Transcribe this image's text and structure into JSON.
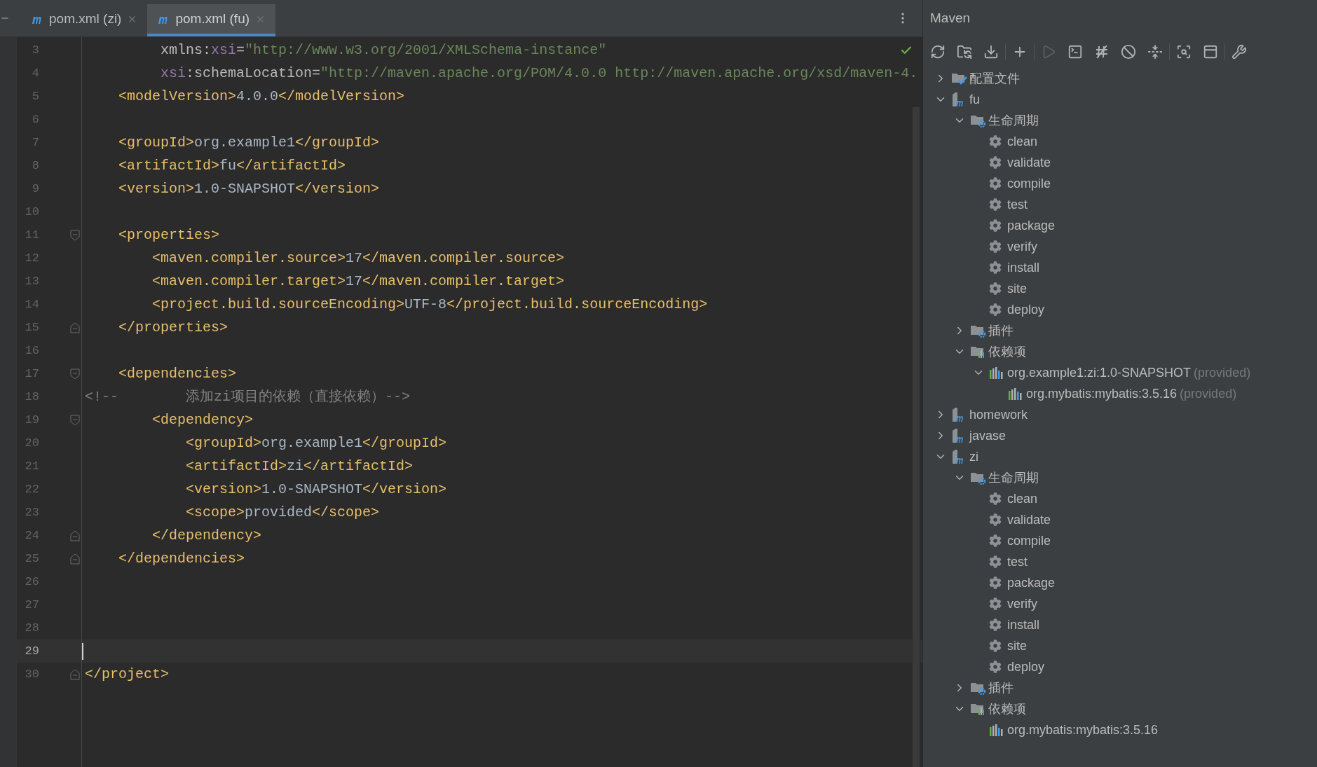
{
  "editor": {
    "tabs": [
      {
        "label": "pom.xml (zi)",
        "selected": false
      },
      {
        "label": "pom.xml (fu)",
        "selected": true
      }
    ],
    "lines": [
      {
        "number": "3",
        "current": false,
        "kind": "plain",
        "segments": [
          {
            "kind": "attr",
            "text": "         xmlns:"
          },
          {
            "kind": "ns",
            "text": "xsi"
          },
          {
            "kind": "attr",
            "text": "="
          },
          {
            "kind": "string",
            "text": "\"http://www.w3.org/2001/XMLSchema-instance\""
          }
        ]
      },
      {
        "number": "4",
        "current": false,
        "kind": "plain",
        "segments": [
          {
            "kind": "ns",
            "text": "         xsi"
          },
          {
            "kind": "attr",
            "text": ":schemaLocation="
          },
          {
            "kind": "string",
            "text": "\"http://maven.apache.org/POM/4.0.0 http://maven.apache.org/xsd/maven-4."
          }
        ]
      },
      {
        "number": "5",
        "current": false,
        "kind": "plain",
        "segments": [
          {
            "kind": "tag",
            "text": "    <modelVersion>"
          },
          {
            "kind": "text",
            "text": "4.0.0"
          },
          {
            "kind": "tag",
            "text": "</modelVersion>"
          }
        ]
      },
      {
        "number": "6",
        "current": false,
        "kind": "plain"
      },
      {
        "number": "7",
        "current": false,
        "kind": "plain",
        "segments": [
          {
            "kind": "tag",
            "text": "    <groupId>"
          },
          {
            "kind": "text",
            "text": "org.example1"
          },
          {
            "kind": "tag",
            "text": "</groupId>"
          }
        ]
      },
      {
        "number": "8",
        "current": false,
        "kind": "plain",
        "segments": [
          {
            "kind": "tag",
            "text": "    <artifactId>"
          },
          {
            "kind": "text",
            "text": "fu"
          },
          {
            "kind": "tag",
            "text": "</artifactId>"
          }
        ]
      },
      {
        "number": "9",
        "current": false,
        "kind": "plain",
        "segments": [
          {
            "kind": "tag",
            "text": "    <version>"
          },
          {
            "kind": "text",
            "text": "1.0-SNAPSHOT"
          },
          {
            "kind": "tag",
            "text": "</version>"
          }
        ]
      },
      {
        "number": "10",
        "current": false,
        "kind": "plain"
      },
      {
        "number": "11",
        "current": false,
        "kind": "fold-open",
        "segments": [
          {
            "kind": "tag",
            "text": "    <properties>"
          }
        ]
      },
      {
        "number": "12",
        "current": false,
        "kind": "plain",
        "segments": [
          {
            "kind": "tag",
            "text": "        <maven.compiler.source>"
          },
          {
            "kind": "text",
            "text": "17"
          },
          {
            "kind": "tag",
            "text": "</maven.compiler.source>"
          }
        ]
      },
      {
        "number": "13",
        "current": false,
        "kind": "plain",
        "segments": [
          {
            "kind": "tag",
            "text": "        <maven.compiler.target>"
          },
          {
            "kind": "text",
            "text": "17"
          },
          {
            "kind": "tag",
            "text": "</maven.compiler.target>"
          }
        ]
      },
      {
        "number": "14",
        "current": false,
        "kind": "plain",
        "segments": [
          {
            "kind": "tag",
            "text": "        <project.build.sourceEncoding>"
          },
          {
            "kind": "text",
            "text": "UTF-8"
          },
          {
            "kind": "tag",
            "text": "</project.build.sourceEncoding>"
          }
        ]
      },
      {
        "number": "15",
        "current": false,
        "kind": "fold-close",
        "segments": [
          {
            "kind": "tag",
            "text": "    </properties>"
          }
        ]
      },
      {
        "number": "16",
        "current": false,
        "kind": "plain"
      },
      {
        "number": "17",
        "current": false,
        "kind": "fold-open",
        "segments": [
          {
            "kind": "tag",
            "text": "    <dependencies>"
          }
        ]
      },
      {
        "number": "18",
        "current": false,
        "kind": "plain",
        "segments": [
          {
            "kind": "comment",
            "text": "<!--        添加zi项目的依赖（直接依赖）-->"
          }
        ]
      },
      {
        "number": "19",
        "current": false,
        "kind": "fold-open",
        "segments": [
          {
            "kind": "tag",
            "text": "        <dependency>"
          }
        ]
      },
      {
        "number": "20",
        "current": false,
        "kind": "plain",
        "segments": [
          {
            "kind": "tag",
            "text": "            <groupId>"
          },
          {
            "kind": "text",
            "text": "org.example1"
          },
          {
            "kind": "tag",
            "text": "</groupId>"
          }
        ]
      },
      {
        "number": "21",
        "current": false,
        "kind": "plain",
        "segments": [
          {
            "kind": "tag",
            "text": "            <artifactId>"
          },
          {
            "kind": "text",
            "text": "zi"
          },
          {
            "kind": "tag",
            "text": "</artifactId>"
          }
        ]
      },
      {
        "number": "22",
        "current": false,
        "kind": "plain",
        "segments": [
          {
            "kind": "tag",
            "text": "            <version>"
          },
          {
            "kind": "text",
            "text": "1.0-SNAPSHOT"
          },
          {
            "kind": "tag",
            "text": "</version>"
          }
        ]
      },
      {
        "number": "23",
        "current": false,
        "kind": "plain",
        "segments": [
          {
            "kind": "tag",
            "text": "            <scope>"
          },
          {
            "kind": "text",
            "text": "provided"
          },
          {
            "kind": "tag",
            "text": "</scope>"
          }
        ]
      },
      {
        "number": "24",
        "current": false,
        "kind": "fold-close",
        "segments": [
          {
            "kind": "tag",
            "text": "        </dependency>"
          }
        ]
      },
      {
        "number": "25",
        "current": false,
        "kind": "fold-close",
        "segments": [
          {
            "kind": "tag",
            "text": "    </dependencies>"
          }
        ]
      },
      {
        "number": "26",
        "current": false,
        "kind": "plain"
      },
      {
        "number": "27",
        "current": false,
        "kind": "plain"
      },
      {
        "number": "28",
        "current": false,
        "kind": "plain"
      },
      {
        "number": "29",
        "current": true,
        "kind": "plain"
      },
      {
        "number": "30",
        "current": false,
        "kind": "fold-close",
        "segments": [
          {
            "kind": "tag",
            "text": "</project>"
          }
        ]
      }
    ]
  },
  "maven": {
    "title": "Maven",
    "toolbar": [
      {
        "kind": "reload",
        "disabled": false
      },
      {
        "kind": "reload-folder",
        "disabled": false
      },
      {
        "kind": "download",
        "disabled": false
      },
      {
        "kind": "add",
        "disabled": false
      },
      {
        "kind": "run",
        "disabled": true
      },
      {
        "kind": "console",
        "disabled": false
      },
      {
        "kind": "offline",
        "disabled": false
      },
      {
        "kind": "skip",
        "disabled": false
      },
      {
        "kind": "collapse",
        "disabled": false
      },
      {
        "kind": "analyze",
        "disabled": false
      },
      {
        "kind": "structure",
        "disabled": false
      },
      {
        "kind": "settings",
        "disabled": false
      }
    ],
    "tree": [
      {
        "label": "配置文件",
        "kind": "profiles",
        "expanded": false
      },
      {
        "label": "fu",
        "kind": "project",
        "expanded": true,
        "children": [
          {
            "label": "生命周期",
            "kind": "lifecycle",
            "expanded": true,
            "children": [
              {
                "label": "clean",
                "kind": "goal"
              },
              {
                "label": "validate",
                "kind": "goal"
              },
              {
                "label": "compile",
                "kind": "goal"
              },
              {
                "label": "test",
                "kind": "goal"
              },
              {
                "label": "package",
                "kind": "goal"
              },
              {
                "label": "verify",
                "kind": "goal"
              },
              {
                "label": "install",
                "kind": "goal"
              },
              {
                "label": "site",
                "kind": "goal"
              },
              {
                "label": "deploy",
                "kind": "goal"
              }
            ]
          },
          {
            "label": "插件",
            "kind": "plugins",
            "expanded": false
          },
          {
            "label": "依赖项",
            "kind": "dependencies",
            "expanded": true,
            "children": [
              {
                "label": "org.example1:zi:1.0-SNAPSHOT",
                "note": "(provided)",
                "kind": "dependency",
                "expanded": true,
                "children": [
                  {
                    "label": "org.mybatis:mybatis:3.5.16",
                    "note": "(provided)",
                    "kind": "dependency"
                  }
                ]
              }
            ]
          }
        ]
      },
      {
        "label": "homework",
        "kind": "project",
        "expanded": false
      },
      {
        "label": "javase",
        "kind": "project",
        "expanded": false
      },
      {
        "label": "zi",
        "kind": "project",
        "expanded": true,
        "children": [
          {
            "label": "生命周期",
            "kind": "lifecycle",
            "expanded": true,
            "children": [
              {
                "label": "clean",
                "kind": "goal"
              },
              {
                "label": "validate",
                "kind": "goal"
              },
              {
                "label": "compile",
                "kind": "goal"
              },
              {
                "label": "test",
                "kind": "goal"
              },
              {
                "label": "package",
                "kind": "goal"
              },
              {
                "label": "verify",
                "kind": "goal"
              },
              {
                "label": "install",
                "kind": "goal"
              },
              {
                "label": "site",
                "kind": "goal"
              },
              {
                "label": "deploy",
                "kind": "goal"
              }
            ]
          },
          {
            "label": "插件",
            "kind": "plugins",
            "expanded": false
          },
          {
            "label": "依赖项",
            "kind": "dependencies",
            "expanded": true,
            "children": [
              {
                "label": "org.mybatis:mybatis:3.5.16",
                "kind": "dependency"
              }
            ]
          }
        ]
      }
    ]
  }
}
